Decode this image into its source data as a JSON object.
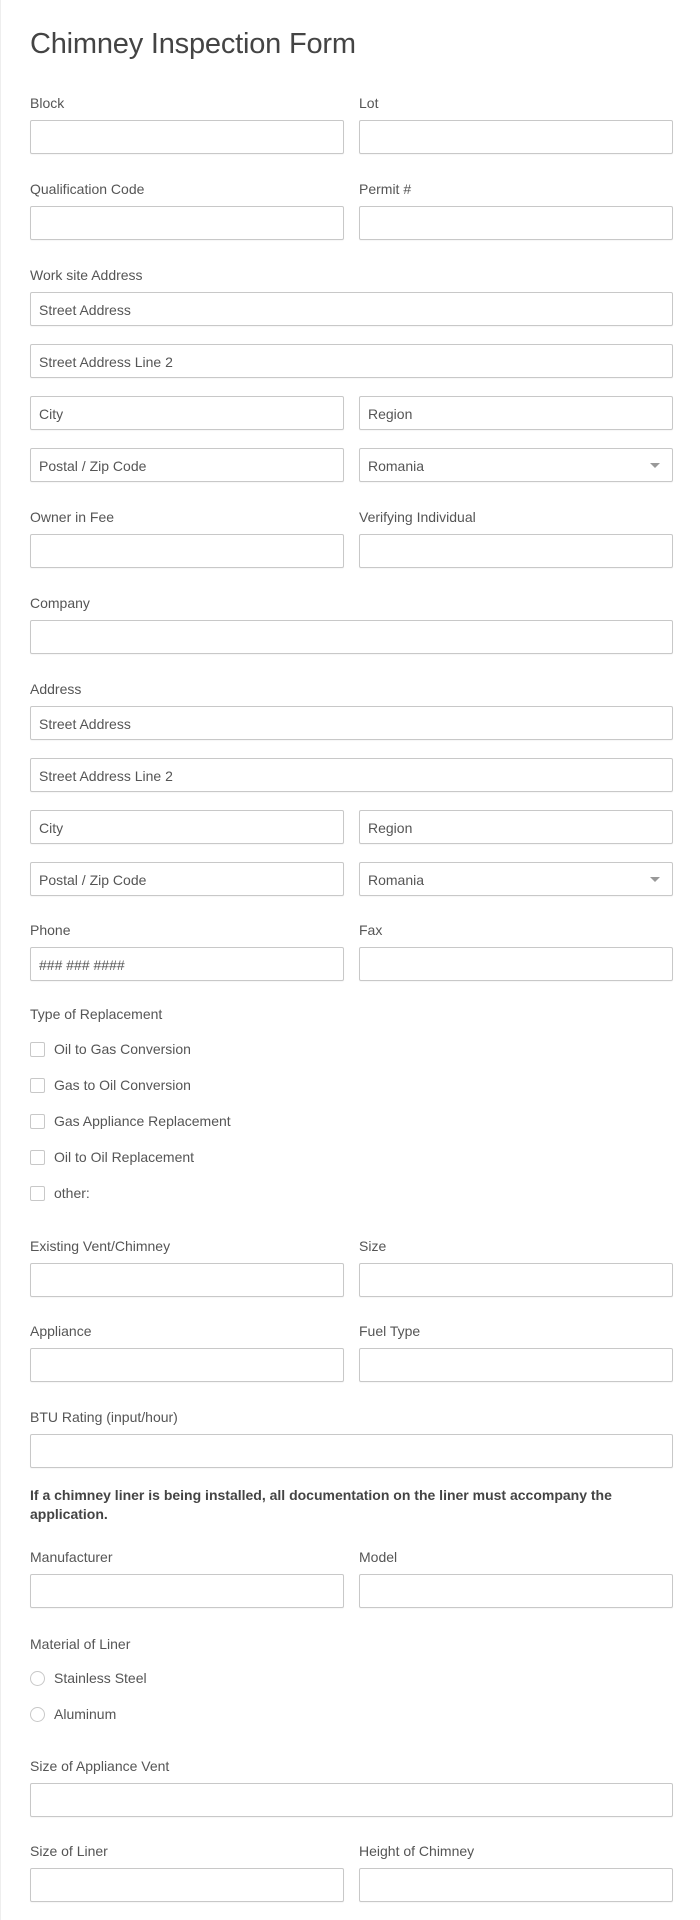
{
  "form": {
    "title": "Chimney Inspection Form",
    "fields": {
      "block": {
        "label": "Block",
        "value": ""
      },
      "lot": {
        "label": "Lot",
        "value": ""
      },
      "qualification_code": {
        "label": "Qualification Code",
        "value": ""
      },
      "permit": {
        "label": "Permit #",
        "value": ""
      },
      "work_site_address": {
        "label": "Work site Address",
        "street": "Street Address",
        "street2": "Street Address Line 2",
        "city": "City",
        "region": "Region",
        "postal": "Postal / Zip Code",
        "country": "Romania"
      },
      "owner_in_fee": {
        "label": "Owner in Fee",
        "value": ""
      },
      "verifying_individual": {
        "label": "Verifying Individual",
        "value": ""
      },
      "company": {
        "label": "Company",
        "value": ""
      },
      "address": {
        "label": "Address",
        "street": "Street Address",
        "street2": "Street Address Line 2",
        "city": "City",
        "region": "Region",
        "postal": "Postal / Zip Code",
        "country": "Romania"
      },
      "phone": {
        "label": "Phone",
        "placeholder": "### ### ####"
      },
      "fax": {
        "label": "Fax",
        "value": ""
      },
      "type_of_replacement": {
        "label": "Type of Replacement",
        "options": [
          {
            "label": "Oil to Gas Conversion",
            "checked": false
          },
          {
            "label": "Gas to Oil Conversion",
            "checked": false
          },
          {
            "label": "Gas Appliance Replacement",
            "checked": false
          },
          {
            "label": "Oil to Oil Replacement",
            "checked": false
          },
          {
            "label": "other:",
            "checked": false
          }
        ]
      },
      "existing_vent": {
        "label": "Existing Vent/Chimney",
        "value": ""
      },
      "size": {
        "label": "Size",
        "value": ""
      },
      "appliance": {
        "label": "Appliance",
        "value": ""
      },
      "fuel_type": {
        "label": "Fuel Type",
        "value": ""
      },
      "btu_rating": {
        "label": "BTU Rating (input/hour)",
        "value": ""
      },
      "liner_note": "If a chimney liner is being installed, all documentation on the liner must accompany the application.",
      "manufacturer": {
        "label": "Manufacturer",
        "value": ""
      },
      "model": {
        "label": "Model",
        "value": ""
      },
      "material_of_liner": {
        "label": "Material of Liner",
        "options": [
          {
            "label": "Stainless Steel",
            "selected": false
          },
          {
            "label": "Aluminum",
            "selected": false
          }
        ]
      },
      "size_of_appliance_vent": {
        "label": "Size of Appliance Vent",
        "value": ""
      },
      "size_of_liner": {
        "label": "Size of Liner",
        "value": ""
      },
      "height_of_chimney": {
        "label": "Height of Chimney",
        "value": ""
      }
    }
  }
}
